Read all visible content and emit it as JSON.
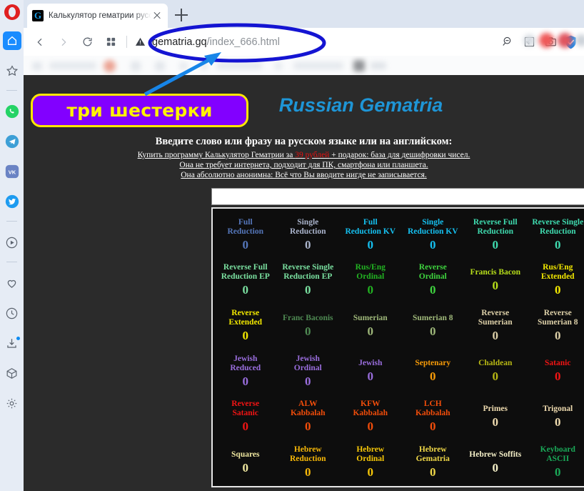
{
  "browser": {
    "logo": "opera-logo",
    "tab": {
      "favicon": "G",
      "title": "Калькулятор гематрии русск",
      "close_label": "×"
    },
    "new_tab_label": "+",
    "address": {
      "domain": "gematria.gq",
      "path": "/index_666.html",
      "security_icon": "warning-triangle-icon"
    },
    "toolbar_icons": [
      "search-page-icon",
      "pin-tab-icon",
      "snapshot-icon",
      "vpn-shield-icon"
    ],
    "nav_icons": [
      "back-arrow-icon",
      "forward-arrow-icon",
      "reload-icon",
      "tab-grid-icon"
    ]
  },
  "sidebar": {
    "items": [
      {
        "name": "home-icon",
        "label": "Home"
      },
      {
        "name": "star-icon",
        "label": "Favorites"
      },
      {
        "name": "whatsapp-icon",
        "label": "WhatsApp"
      },
      {
        "name": "telegram-icon",
        "label": "Telegram"
      },
      {
        "name": "vk-icon",
        "label": "VK"
      },
      {
        "name": "twitter-icon",
        "label": "Twitter"
      },
      {
        "name": "player-icon",
        "label": "Player"
      },
      {
        "name": "heart-icon",
        "label": "Favorites"
      },
      {
        "name": "history-clock-icon",
        "label": "History"
      },
      {
        "name": "downloads-icon",
        "label": "Downloads"
      },
      {
        "name": "extensions-box-icon",
        "label": "Extensions"
      },
      {
        "name": "settings-gear-icon",
        "label": "Settings"
      }
    ]
  },
  "annotation": {
    "callout_text": "три шестерки",
    "callout_bg": "#8200ff",
    "callout_border": "#ffe600",
    "callout_color": "#fff200",
    "arrow_color": "#1785e8",
    "ellipse_color": "#1414d2"
  },
  "page": {
    "title": "Russian Gematria",
    "title_color": "#1e95d6",
    "heading": "Введите слово или фразу на русском языке или на английском:",
    "ad_lines": [
      {
        "pre": "Купить программу Калькулятор Гематрии за ",
        "price": "39 рублей",
        "post": " + подарок: база для дешифровки чисел."
      },
      {
        "pre": "Она не требует интернета, подходит для ПК, смартфона или планшета.",
        "price": "",
        "post": ""
      },
      {
        "pre": "Она абсолютно анонимна: Всё что Вы вводите нигде не записывается.",
        "price": "",
        "post": ""
      }
    ],
    "input_value": "",
    "input_placeholder": "",
    "ciphers": [
      {
        "label": "Full\nReduction",
        "value": "0",
        "color": "#5577bb"
      },
      {
        "label": "Single\nReduction",
        "value": "0",
        "color": "#aab4cc"
      },
      {
        "label": "Full\nReduction KV",
        "value": "0",
        "color": "#15c0f0"
      },
      {
        "label": "Single\nReduction KV",
        "value": "0",
        "color": "#15c0f0"
      },
      {
        "label": "Reverse Full\nReduction",
        "value": "0",
        "color": "#3fdcb0"
      },
      {
        "label": "Reverse Single\nReduction",
        "value": "0",
        "color": "#3fdcb0"
      },
      {
        "label": "Reverse Full\nReduction EP",
        "value": "0",
        "color": "#7ae0a0"
      },
      {
        "label": "Reverse Single\nReduction EP",
        "value": "0",
        "color": "#7ae0a0"
      },
      {
        "label": "Rus/Eng\nOrdinal",
        "value": "0",
        "color": "#22b422"
      },
      {
        "label": "Reverse\nOrdinal",
        "value": "0",
        "color": "#3fd43f"
      },
      {
        "label": "Francis Bacon",
        "value": "0",
        "color": "#b8e01a"
      },
      {
        "label": "Rus/Eng\nExtended",
        "value": "0",
        "color": "#f2e800"
      },
      {
        "label": "Reverse\nExtended",
        "value": "0",
        "color": "#f2e800"
      },
      {
        "label": "Franc Baconis",
        "value": "0",
        "color": "#4f8a53"
      },
      {
        "label": "Sumerian",
        "value": "0",
        "color": "#9fb87a"
      },
      {
        "label": "Sumerian 8",
        "value": "0",
        "color": "#9fb87a"
      },
      {
        "label": "Reverse\nSumerian",
        "value": "0",
        "color": "#ddd0a8"
      },
      {
        "label": "Reverse\nSumerian 8",
        "value": "0",
        "color": "#ddd0a8"
      },
      {
        "label": "Jewish\nReduced",
        "value": "0",
        "color": "#9a6ede"
      },
      {
        "label": "Jewish\nOrdinal",
        "value": "0",
        "color": "#9a6ede"
      },
      {
        "label": "Jewish",
        "value": "0",
        "color": "#9a6ede"
      },
      {
        "label": "Septenary",
        "value": "0",
        "color": "#f79b08"
      },
      {
        "label": "Chaldean",
        "value": "0",
        "color": "#b8b814"
      },
      {
        "label": "Satanic",
        "value": "0",
        "color": "#f21414"
      },
      {
        "label": "Reverse\nSatanic",
        "value": "0",
        "color": "#f21414"
      },
      {
        "label": "ALW\nKabbalah",
        "value": "0",
        "color": "#f24d0a"
      },
      {
        "label": "KFW\nKabbalah",
        "value": "0",
        "color": "#f24d0a"
      },
      {
        "label": "LCH\nKabbalah",
        "value": "0",
        "color": "#f24d0a"
      },
      {
        "label": "Primes",
        "value": "0",
        "color": "#f0dcb0"
      },
      {
        "label": "Trigonal",
        "value": "0",
        "color": "#f0dcb0"
      },
      {
        "label": "Squares",
        "value": "0",
        "color": "#f0e8a0"
      },
      {
        "label": "Hebrew\nReduction",
        "value": "0",
        "color": "#f7b808"
      },
      {
        "label": "Hebrew\nOrdinal",
        "value": "0",
        "color": "#f7c808"
      },
      {
        "label": "Hebrew\nGematria",
        "value": "0",
        "color": "#f0d848"
      },
      {
        "label": "Hebrew Soffits",
        "value": "0",
        "color": "#f5f0c8"
      },
      {
        "label": "Keyboard\nASCII",
        "value": "0",
        "color": "#1aa858"
      }
    ]
  }
}
